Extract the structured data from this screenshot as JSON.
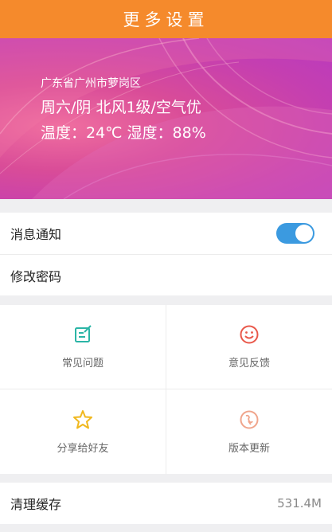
{
  "header": {
    "title": "更多设置"
  },
  "weather": {
    "location": "广东省广州市萝岗区",
    "summary": "周六/阴 北风1级/空气优",
    "details": "温度：24℃ 湿度：88%"
  },
  "settings": {
    "notifications_label": "消息通知",
    "notifications_on": true,
    "change_password_label": "修改密码"
  },
  "actions": [
    {
      "label": "常见问题",
      "icon": "faq-edit-icon",
      "color": "#2bb5a6"
    },
    {
      "label": "意见反馈",
      "icon": "smiley-icon",
      "color": "#e9584a"
    },
    {
      "label": "分享给好友",
      "icon": "star-icon",
      "color": "#f0b81e"
    },
    {
      "label": "版本更新",
      "icon": "update-icon",
      "color": "#f0a58c"
    }
  ],
  "cache": {
    "label": "清理缓存",
    "value": "531.4M"
  },
  "colors": {
    "header": "#f58a2c",
    "toggle": "#3b9ae0"
  }
}
